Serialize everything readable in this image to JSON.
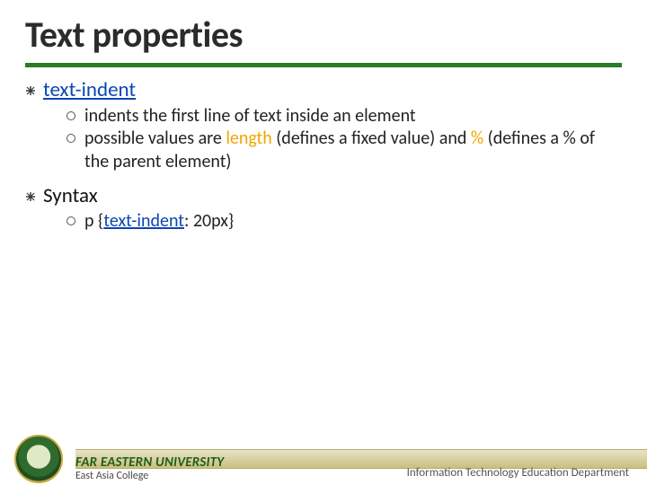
{
  "title": "Text properties",
  "items": [
    {
      "head": "text-indent",
      "linkStyle": true,
      "subs": [
        {
          "segments": [
            {
              "t": " indents the first line of text inside an element"
            }
          ]
        },
        {
          "segments": [
            {
              "t": " possible values are "
            },
            {
              "t": "length",
              "hl": true
            },
            {
              "t": " (defines a fixed value) and "
            },
            {
              "t": "%",
              "hl": true
            },
            {
              "t": " (defines a % of the parent element)"
            }
          ]
        }
      ]
    },
    {
      "head": "Syntax",
      "linkStyle": false,
      "subs": [
        {
          "segments": [
            {
              "t": " p {"
            },
            {
              "t": "text-indent",
              "codeLink": true
            },
            {
              "t": ": 20px}"
            }
          ]
        }
      ]
    }
  ],
  "footer": {
    "university": "FAR EASTERN UNIVERSITY",
    "college": "East Asia College",
    "department": "Information Technology Education Department"
  }
}
